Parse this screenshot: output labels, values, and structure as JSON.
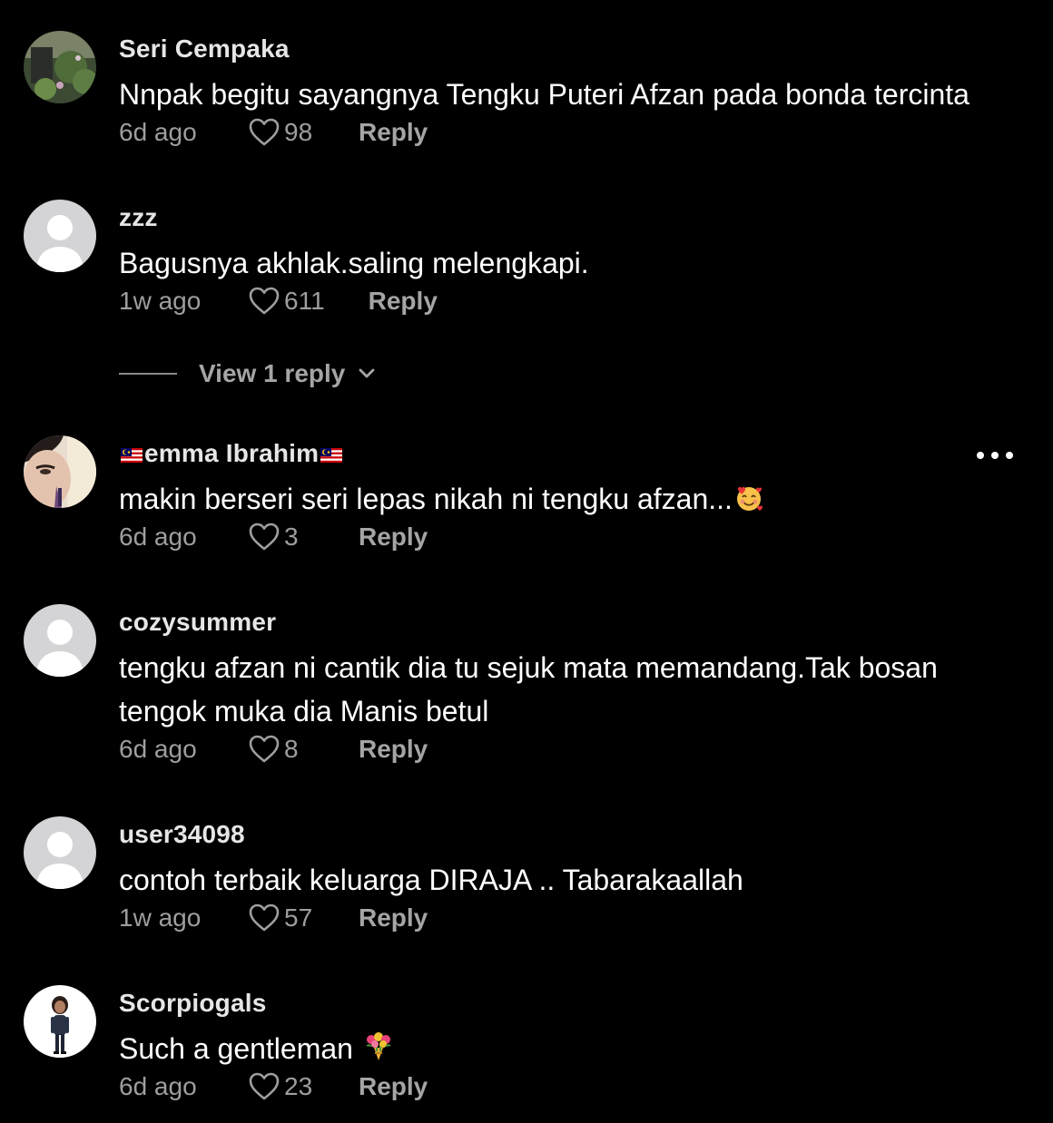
{
  "comments": [
    {
      "username": "Seri Cempaka",
      "text": "Nnpak begitu sayangnya Tengku Puteri Afzan pada bonda tercinta",
      "time": "6d ago",
      "likes": "98",
      "reply_label": "Reply",
      "avatar": "garden-photo"
    },
    {
      "username": "zzz",
      "text": "Bagusnya akhlak.saling melengkapi.",
      "time": "1w ago",
      "likes": "611",
      "reply_label": "Reply",
      "avatar": "default-avatar",
      "view_replies": "View 1 reply"
    },
    {
      "username": "emma Ibrahim",
      "username_flag": "malaysia-flag",
      "text": "makin berseri seri lepas nikah ni tengku afzan...",
      "text_emoji": "smiling-face-with-hearts",
      "time": "6d ago",
      "likes": "3",
      "reply_label": "Reply",
      "avatar": "woman-face-photo"
    },
    {
      "username": "cozysummer",
      "text": "tengku afzan ni cantik dia tu sejuk mata memandang.Tak bosan tengok muka dia Manis betul",
      "time": "6d ago",
      "likes": "8",
      "reply_label": "Reply",
      "avatar": "default-avatar"
    },
    {
      "username": "user34098",
      "text": "contoh terbaik keluarga DIRAJA .. Tabarakaallah",
      "time": "1w ago",
      "likes": "57",
      "reply_label": "Reply",
      "avatar": "default-avatar"
    },
    {
      "username": "Scorpiogals",
      "text": "Such a gentleman",
      "text_emoji": "bouquet",
      "time": "6d ago",
      "likes": "23",
      "reply_label": "Reply",
      "avatar": "avatar-figure"
    }
  ],
  "colors": {
    "background": "#000000",
    "text": "#ffffff",
    "meta": "#9e9e9e",
    "default_avatar_bg": "#d4d4d6"
  }
}
